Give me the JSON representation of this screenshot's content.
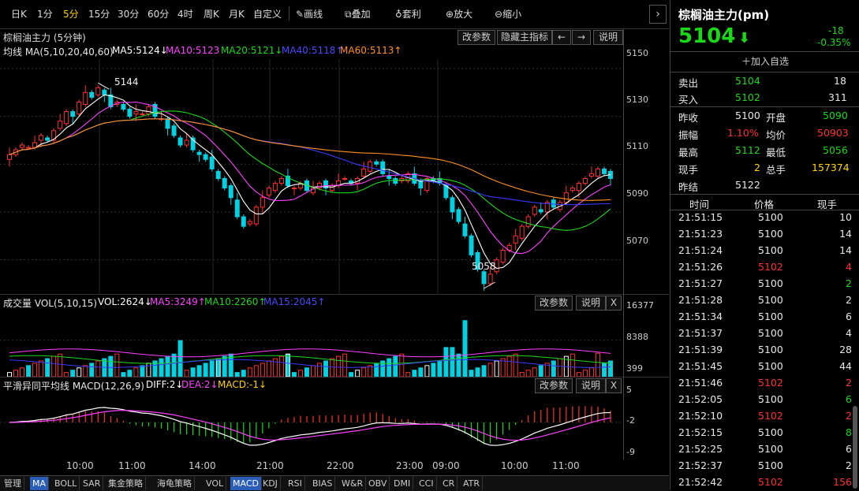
{
  "toolbar": {
    "periods": [
      "日K",
      "1分",
      "5分",
      "15分",
      "30分",
      "60分",
      "4时",
      "周K",
      "月K",
      "自定义"
    ],
    "active_period": "5分",
    "tools": [
      {
        "icon": "pencil-icon",
        "label": "画线"
      },
      {
        "icon": "layers-icon",
        "label": "叠加"
      },
      {
        "icon": "money-bag-icon",
        "label": "套利"
      },
      {
        "icon": "zoom-in-icon",
        "label": "放大"
      },
      {
        "icon": "zoom-out-icon",
        "label": "缩小"
      }
    ],
    "more": "›"
  },
  "main": {
    "title": "棕榈油主力 (5分钟)",
    "buttons": [
      "改参数",
      "隐藏主指标",
      "←",
      "→",
      "说明"
    ],
    "ma_label": "均线 MA(5,10,20,40,60)",
    "ma_values": [
      {
        "text": "MA5:5124↓",
        "color": "#ffffff"
      },
      {
        "text": "MA10:5123",
        "color": "#ff40ff"
      },
      {
        "text": "MA20:5121↓",
        "color": "#18d818"
      },
      {
        "text": "MA40:5118↑",
        "color": "#3a3aff"
      },
      {
        "text": "MA60:5113↑",
        "color": "#ff9020"
      }
    ],
    "y_axis": [
      "5150",
      "5130",
      "5110",
      "5090",
      "5070"
    ],
    "high_mark": "5144",
    "low_mark": "5058"
  },
  "volume": {
    "label": "成交量 VOL(5,10,15)",
    "vol": "VOL:2624↓",
    "ma5": "MA5:3249↑",
    "ma10": "MA10:2260↑",
    "ma15": "MA15:2045↑",
    "buttons": [
      "改参数",
      "说明",
      "X"
    ],
    "y_axis": [
      "16377",
      "8388",
      "399"
    ]
  },
  "macd": {
    "label": "平滑异同平均线 MACD(12,26,9)",
    "diff": "DIFF:2↓",
    "dea": "DEA:2↓",
    "macd": "MACD:-1↓",
    "buttons": [
      "改参数",
      "说明",
      "X"
    ],
    "y_axis": [
      "5",
      "-2",
      "-9"
    ]
  },
  "time_axis": [
    "10:00",
    "11:00",
    "14:00",
    "21:00",
    "22:00",
    "23:00",
    "09:00",
    "10:00",
    "11:00"
  ],
  "tabs": [
    "管理",
    "MA",
    "BOLL",
    "SAR",
    "集金策略",
    "海龟策略",
    "VOL",
    "MACD",
    "KDJ",
    "RSI",
    "BIAS",
    "W&R",
    "OBV",
    "DMI",
    "CCI",
    "CR",
    "ATR"
  ],
  "tabs_on": [
    "MA",
    "MACD"
  ],
  "quote": {
    "title": "棕榈油主力(pm)",
    "price": "5104",
    "change": "-18",
    "change_pct": "-0.35%",
    "add_watch": "加入自选",
    "sell_label": "卖出",
    "sell_price": "5104",
    "sell_vol": "18",
    "buy_label": "买入",
    "buy_price": "5102",
    "buy_vol": "311",
    "stats": [
      {
        "l1": "昨收",
        "v1": "5100",
        "c1": "w",
        "l2": "开盘",
        "v2": "5090",
        "c2": "g"
      },
      {
        "l1": "振幅",
        "v1": "1.10%",
        "c1": "r",
        "l2": "均价",
        "v2": "50903",
        "c2": "r"
      },
      {
        "l1": "最高",
        "v1": "5112",
        "c1": "g",
        "l2": "最低",
        "v2": "5056",
        "c2": "g"
      },
      {
        "l1": "现手",
        "v1": "2",
        "c1": "y",
        "l2": "总手",
        "v2": "157374",
        "c2": "y"
      },
      {
        "l1": "昨结",
        "v1": "5122",
        "c1": "w",
        "l2": "",
        "v2": "",
        "c2": "w"
      }
    ],
    "ticks_header": [
      "时间",
      "价格",
      "现手"
    ],
    "ticks": [
      {
        "t": "21:51:15",
        "p": "5100",
        "pc": "w",
        "v": "10",
        "vc": "w"
      },
      {
        "t": "21:51:23",
        "p": "5100",
        "pc": "w",
        "v": "14",
        "vc": "w"
      },
      {
        "t": "21:51:24",
        "p": "5100",
        "pc": "w",
        "v": "14",
        "vc": "w"
      },
      {
        "t": "21:51:26",
        "p": "5102",
        "pc": "r",
        "v": "4",
        "vc": "r"
      },
      {
        "t": "21:51:27",
        "p": "5100",
        "pc": "w",
        "v": "2",
        "vc": "g"
      },
      {
        "t": "21:51:28",
        "p": "5100",
        "pc": "w",
        "v": "2",
        "vc": "w"
      },
      {
        "t": "21:51:34",
        "p": "5100",
        "pc": "w",
        "v": "6",
        "vc": "w"
      },
      {
        "t": "21:51:37",
        "p": "5100",
        "pc": "w",
        "v": "4",
        "vc": "w"
      },
      {
        "t": "21:51:39",
        "p": "5100",
        "pc": "w",
        "v": "28",
        "vc": "w"
      },
      {
        "t": "21:51:45",
        "p": "5100",
        "pc": "w",
        "v": "44",
        "vc": "w"
      },
      {
        "t": "21:51:46",
        "p": "5102",
        "pc": "r",
        "v": "2",
        "vc": "r"
      },
      {
        "t": "21:52:05",
        "p": "5100",
        "pc": "w",
        "v": "6",
        "vc": "g"
      },
      {
        "t": "21:52:10",
        "p": "5102",
        "pc": "r",
        "v": "2",
        "vc": "r"
      },
      {
        "t": "21:52:15",
        "p": "5100",
        "pc": "w",
        "v": "8",
        "vc": "g"
      },
      {
        "t": "21:52:25",
        "p": "5100",
        "pc": "w",
        "v": "6",
        "vc": "w"
      },
      {
        "t": "21:52:37",
        "p": "5100",
        "pc": "w",
        "v": "2",
        "vc": "w"
      },
      {
        "t": "21:52:42",
        "p": "5102",
        "pc": "r",
        "v": "156",
        "vc": "r"
      }
    ]
  },
  "chart_data": {
    "type": "candlestick",
    "close": [
      5114,
      5116,
      5118,
      5117,
      5119,
      5122,
      5120,
      5124,
      5128,
      5132,
      5130,
      5136,
      5140,
      5138,
      5142,
      5139,
      5134,
      5136,
      5133,
      5130,
      5132,
      5131,
      5134,
      5130,
      5129,
      5125,
      5122,
      5118,
      5120,
      5116,
      5114,
      5112,
      5108,
      5104,
      5100,
      5096,
      5088,
      5084,
      5086,
      5092,
      5096,
      5100,
      5102,
      5104,
      5101,
      5100,
      5102,
      5099,
      5100,
      5102,
      5100,
      5101,
      5103,
      5104,
      5102,
      5104,
      5108,
      5111,
      5110,
      5106,
      5104,
      5102,
      5104,
      5106,
      5102,
      5100,
      5104,
      5103,
      5102,
      5096,
      5090,
      5086,
      5080,
      5072,
      5066,
      5060,
      5064,
      5070,
      5074,
      5076,
      5080,
      5084,
      5088,
      5092,
      5090,
      5094,
      5092,
      5094,
      5098,
      5100,
      5102,
      5104,
      5106,
      5108,
      5106,
      5104
    ],
    "ylim": [
      5058,
      5150
    ],
    "volume_ylim": [
      399,
      16377
    ]
  }
}
